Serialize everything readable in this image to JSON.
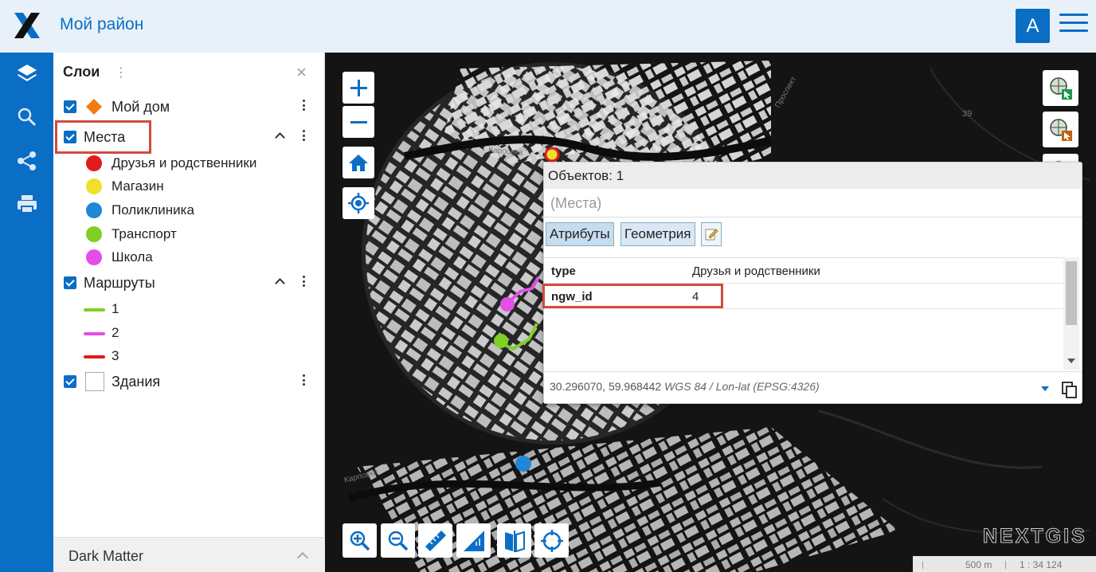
{
  "header": {
    "title": "Мой район",
    "avatar_letter": "A"
  },
  "rail": {
    "icons": [
      "layers-icon",
      "search-icon",
      "share-icon",
      "print-icon"
    ]
  },
  "layers_panel": {
    "title": "Слои",
    "layers": [
      {
        "label": "Мой дом",
        "checked": true,
        "symbol": "diamond",
        "color": "#f07d14"
      },
      {
        "label": "Места",
        "checked": true,
        "expanded": true,
        "legend": [
          {
            "label": "Друзья и родственники",
            "color": "#e3191c"
          },
          {
            "label": "Магазин",
            "color": "#ede12e"
          },
          {
            "label": "Поликлиника",
            "color": "#1e88d8"
          },
          {
            "label": "Транспорт",
            "color": "#7fcf25"
          },
          {
            "label": "Школа",
            "color": "#e44ee8"
          }
        ]
      },
      {
        "label": "Маршруты",
        "checked": true,
        "expanded": true,
        "legend": [
          {
            "label": "1",
            "color": "#7fcf25"
          },
          {
            "label": "2",
            "color": "#e44ee8"
          },
          {
            "label": "3",
            "color": "#e3191c"
          }
        ]
      },
      {
        "label": "Здания",
        "checked": true,
        "symbol": "square",
        "color": "#ffffff"
      }
    ],
    "basemap": "Dark Matter"
  },
  "popup": {
    "count_text": "Объектов: 1",
    "layer_name": "(Места)",
    "tabs": [
      "Атрибуты",
      "Геометрия"
    ],
    "active_tab": "Атрибуты",
    "attributes": [
      {
        "key": "type",
        "value": "Друзья и родственники"
      },
      {
        "key": "ngw_id",
        "value": "4"
      }
    ],
    "coordinates": "30.296070, 59.968442",
    "crs": "WGS 84 / Lon-lat (EPSG:4326)"
  },
  "map": {
    "brand": "NEXTGIS",
    "scale_distance": "500 m",
    "scale_ratio": "1 : 34 124",
    "street_labels": [
      "Карповка",
      "Карповка",
      "Проспект",
      "39"
    ]
  }
}
